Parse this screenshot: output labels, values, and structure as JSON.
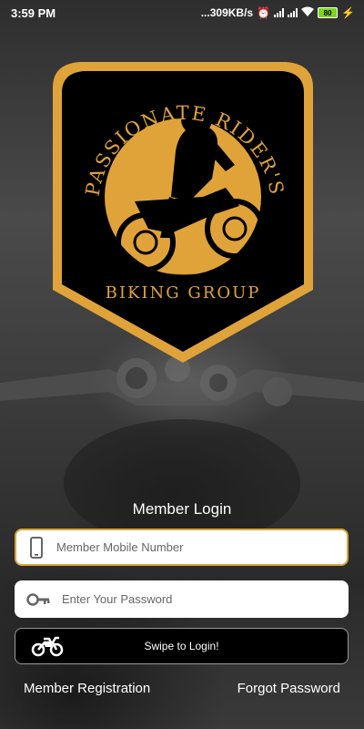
{
  "status_bar": {
    "time": "3:59 PM",
    "network_speed": "...309KB/s",
    "battery": "80",
    "icons": [
      "alarm-off-icon",
      "volte-icon",
      "signal-icon",
      "volte-icon",
      "signal-icon",
      "wifi-icon",
      "battery-icon",
      "charging-icon"
    ]
  },
  "logo": {
    "top_text": "PASSIONATE RIDER'S",
    "bottom_text": "BIKING GROUP",
    "colors": {
      "gold": "#e0a33a",
      "black": "#000000"
    }
  },
  "login": {
    "title": "Member Login",
    "mobile_placeholder": "Member Mobile Number",
    "password_placeholder": "Enter Your Password",
    "swipe_label": "Swipe to Login!"
  },
  "links": {
    "register": "Member Registration",
    "forgot": "Forgot Password"
  },
  "colors": {
    "accent": "#d4a53a",
    "field_bg": "#ffffff",
    "button_bg": "#000000"
  }
}
